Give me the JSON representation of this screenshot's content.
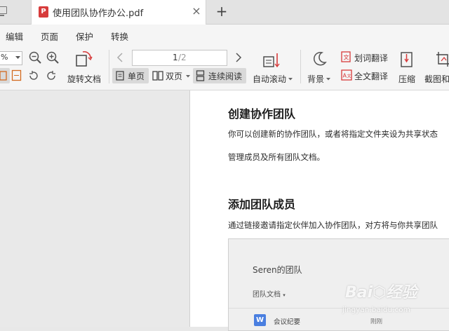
{
  "tab": {
    "title": "使用团队协作办公.pdf",
    "close": "×",
    "new_tab": "+"
  },
  "menu": [
    "编辑",
    "页面",
    "保护",
    "转换"
  ],
  "toolbar": {
    "zoom_value": "%",
    "rotate_label": "旋转文档",
    "page_current": "1",
    "page_total": "/2",
    "single_page": "单页",
    "double_page": "双页",
    "continuous": "连续阅读",
    "auto_scroll": "自动滚动",
    "background": "背景",
    "word_translate": "划词翻译",
    "full_translate": "全文翻译",
    "compress": "压缩",
    "screenshot_compare": "截图和"
  },
  "document": {
    "heading1": "创建协作团队",
    "para1": "你可以创建新的协作团队，或者将指定文件夹设为共享状态",
    "para2": "管理成员及所有团队文档。",
    "heading2": "添加团队成员",
    "para3": "通过链接邀请指定伙伴加入协作团队，对方将与你共享团队"
  },
  "embedded_screenshot": {
    "team_title": "Seren的团队",
    "team_docs": "团队文档",
    "file_icon_letter": "W",
    "file_name": "会议纪要",
    "file_time": "刚刚"
  },
  "watermark": {
    "brand": "Bai⬡经验",
    "url": "jingyan.baidu.com"
  },
  "colors": {
    "accent_red": "#d73b3b",
    "toggle_bg": "#d9d9d9",
    "word_blue": "#4a7fe0"
  }
}
